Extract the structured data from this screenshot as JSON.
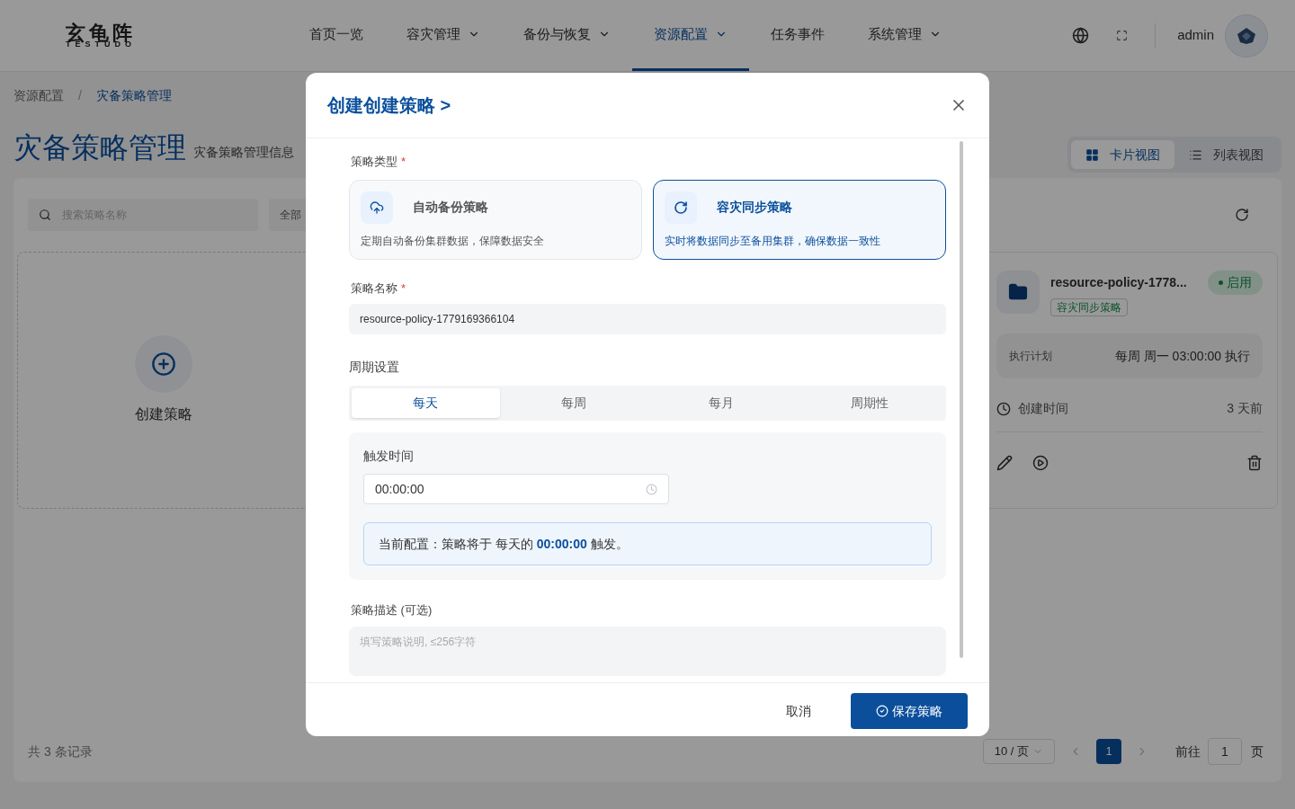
{
  "header": {
    "logo": "玄龟阵",
    "logo_sub": "TESTUDO",
    "user": "admin",
    "nav": [
      {
        "label": "首页一览",
        "dropdown": false,
        "selected": false
      },
      {
        "label": "容灾管理",
        "dropdown": true,
        "selected": false
      },
      {
        "label": "备份与恢复",
        "dropdown": true,
        "selected": false
      },
      {
        "label": "资源配置",
        "dropdown": true,
        "selected": true
      },
      {
        "label": "任务事件",
        "dropdown": false,
        "selected": false
      },
      {
        "label": "系统管理",
        "dropdown": true,
        "selected": false
      }
    ]
  },
  "breadcrumb": [
    {
      "label": "资源配置",
      "selected": false
    },
    {
      "label": "灾备策略管理",
      "selected": true
    }
  ],
  "breadcrumb_separator": "/",
  "page": {
    "title": "灾备策略管理",
    "subtitle": "灾备策略管理信息"
  },
  "view_toggle": [
    {
      "label": "卡片视图",
      "kind": "grid",
      "selected": true
    },
    {
      "label": "列表视图",
      "kind": "list",
      "selected": false
    }
  ],
  "toolbar": {
    "search_placeholder": "搜索策略名称",
    "filter": "全部"
  },
  "create_card": {
    "label": "创建策略"
  },
  "policy_card": {
    "name": "resource-policy-1778...",
    "status": "启用",
    "enabled": true,
    "tag": "容灾同步策略",
    "schedule_label": "执行计划",
    "schedule": "每周 周一 03:00:00 执行",
    "created_label": "创建时间",
    "created": "3 天前"
  },
  "pagination": {
    "total": "共 3 条记录",
    "page_size": "10 / 页",
    "pages": [
      {
        "label": "1",
        "selected": true
      }
    ],
    "goto_label": "前往",
    "goto_value": "1",
    "goto_unit": "页"
  },
  "dialog": {
    "title": "创建创建策略 >",
    "type_label": "策略类型",
    "type_required": "*",
    "types": [
      {
        "kind": "backup",
        "title": "自动备份策略",
        "description": "定期自动备份集群数据，保障数据安全",
        "selected": false
      },
      {
        "kind": "sync",
        "title": "容灾同步策略",
        "description": "实时将数据同步至备用集群，确保数据一致性",
        "selected": true
      }
    ],
    "name_label": "策略名称",
    "name_required": "*",
    "name_value": "resource-policy-1779169366104",
    "period_label": "周期设置",
    "period_tabs": [
      {
        "label": "每天",
        "selected": true
      },
      {
        "label": "每周",
        "selected": false
      },
      {
        "label": "每月",
        "selected": false
      },
      {
        "label": "周期性",
        "selected": false
      }
    ],
    "trigger_label": "触发时间",
    "trigger_value": "00:00:00",
    "summary": "当前配置：策略将于 每天的 **00:00:00** 触发。",
    "desc_label": "策略描述 (可选)",
    "desc_placeholder": "填写策略说明, ≤256字符",
    "cancel": "取消",
    "save": "保存策略"
  }
}
